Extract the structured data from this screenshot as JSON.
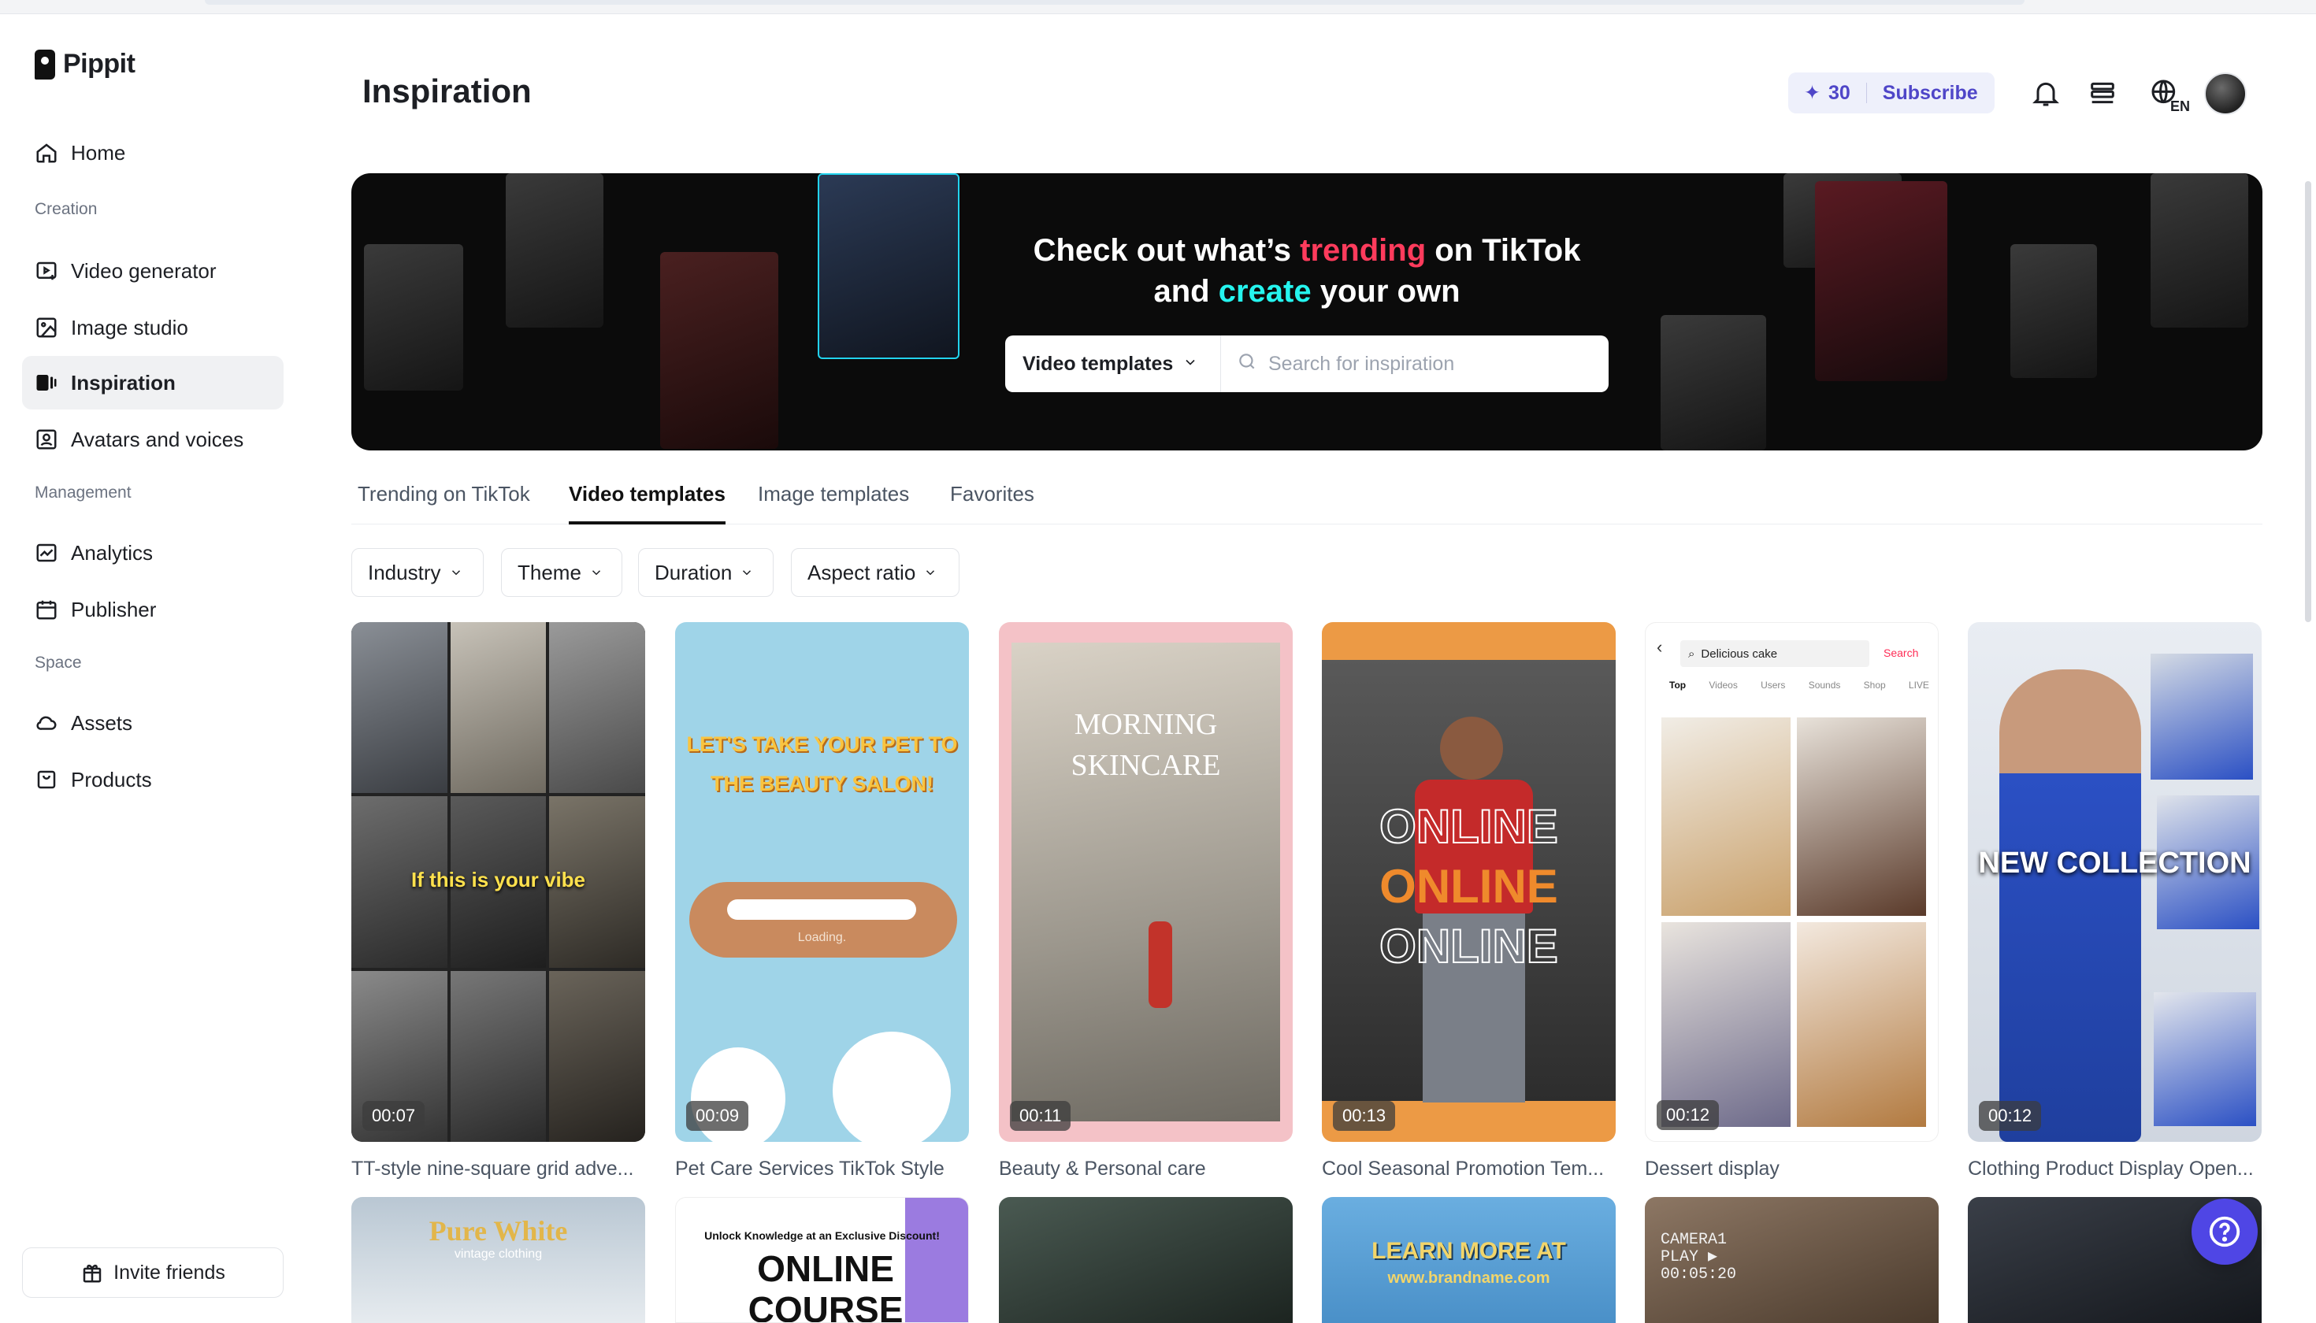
{
  "app": {
    "name": "Pippit"
  },
  "sidebar": {
    "home": "Home",
    "creation_label": "Creation",
    "creation": [
      "Video generator",
      "Image studio",
      "Inspiration",
      "Avatars and voices"
    ],
    "management_label": "Management",
    "management": [
      "Analytics",
      "Publisher"
    ],
    "space_label": "Space",
    "space": [
      "Assets",
      "Products"
    ],
    "invite": "Invite friends",
    "active": "Inspiration"
  },
  "header": {
    "title": "Inspiration",
    "credits": "30",
    "subscribe": "Subscribe",
    "language_badge": "EN"
  },
  "banner": {
    "line1_a": "Check out what’s ",
    "line1_b": "trending",
    "line1_c": " on TikTok",
    "line2_a": "and ",
    "line2_b": "create",
    "line2_c": " your own",
    "select_value": "Video templates",
    "search_placeholder": "Search for inspiration",
    "accent_colors": {
      "trending": "#ff3b5c",
      "create": "#25f4ee"
    }
  },
  "tabs": [
    "Trending on TikTok",
    "Video templates",
    "Image templates",
    "Favorites"
  ],
  "active_tab": "Video templates",
  "filters": [
    "Industry",
    "Theme",
    "Duration",
    "Aspect ratio"
  ],
  "cards": [
    {
      "title": "TT-style nine-square grid adve...",
      "duration": "00:07",
      "overlay": "If this is your vibe"
    },
    {
      "title": "Pet Care Services TikTok Style",
      "duration": "00:09",
      "overlay": "LET'S TAKE YOUR PET TO THE BEAUTY SALON!",
      "sub": "Loading."
    },
    {
      "title": "Beauty & Personal care",
      "duration": "00:11",
      "overlay": "MORNING SKINCARE"
    },
    {
      "title": "Cool Seasonal Promotion Tem...",
      "duration": "00:13",
      "overlay": "ONLINE"
    },
    {
      "title": "Dessert display",
      "duration": "00:12",
      "search_text": "Delicious cake",
      "search_btn": "Search",
      "tabs": [
        "Top",
        "Videos",
        "Users",
        "Sounds",
        "Shop",
        "LIVE"
      ]
    },
    {
      "title": "Clothing Product Display Open...",
      "duration": "00:12",
      "overlay": "NEW COLLECTION"
    }
  ],
  "row2": [
    {
      "overlay": "Pure White",
      "sub": "vintage clothing"
    },
    {
      "overlay": "ONLINE COURSE",
      "sub": "Unlock Knowledge at an Exclusive Discount!"
    },
    {
      "overlay": ""
    },
    {
      "overlay": "LEARN MORE AT",
      "sub": "www.brandname.com"
    },
    {
      "overlay": "CAMERA1 PLAY ▶ 00:05:20"
    },
    {
      "overlay": ""
    }
  ]
}
